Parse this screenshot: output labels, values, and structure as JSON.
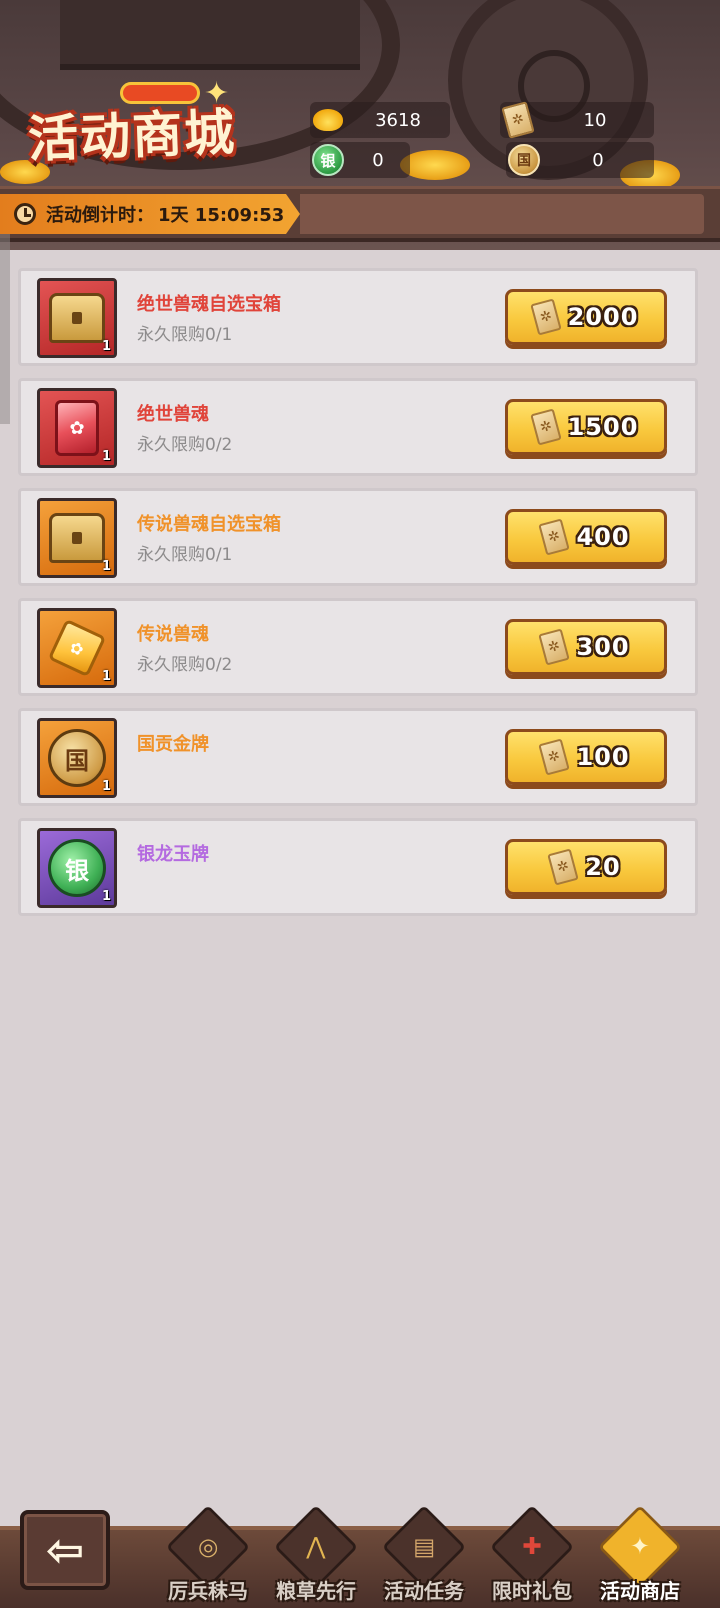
{
  "header": {
    "title": "活动商城",
    "currencies": [
      {
        "icon": "gold-ingot-icon",
        "value": "3618"
      },
      {
        "icon": "activity-ticket-icon",
        "value": "10"
      },
      {
        "icon": "silver-dragon-medal-icon",
        "glyph": "银",
        "value": "0"
      },
      {
        "icon": "national-gold-medal-icon",
        "glyph": "国",
        "value": "0"
      }
    ],
    "countdown_label": "活动倒计时：",
    "countdown_value": "1天 15:09:53"
  },
  "items": [
    {
      "name": "绝世兽魂自选宝箱",
      "name_color": "#e0443a",
      "limit": "永久限购0/1",
      "icon": "chest-icon",
      "frame": "red",
      "qty": "1",
      "price": "2000"
    },
    {
      "name": "绝世兽魂",
      "name_color": "#e0443a",
      "limit": "永久限购0/2",
      "icon": "red-beast-soul-gem-icon",
      "frame": "red",
      "qty": "1",
      "price": "1500"
    },
    {
      "name": "传说兽魂自选宝箱",
      "name_color": "#f0922a",
      "limit": "永久限购0/1",
      "icon": "chest-icon",
      "frame": "orange",
      "qty": "1",
      "price": "400"
    },
    {
      "name": "传说兽魂",
      "name_color": "#f0922a",
      "limit": "永久限购0/2",
      "icon": "orange-beast-soul-gem-icon",
      "frame": "orange",
      "qty": "1",
      "price": "300"
    },
    {
      "name": "国贡金牌",
      "name_color": "#f0922a",
      "limit": "",
      "icon": "national-gold-medal-icon",
      "frame": "orange",
      "qty": "1",
      "price": "100",
      "glyph": "国"
    },
    {
      "name": "银龙玉牌",
      "name_color": "#b46ae0",
      "limit": "",
      "icon": "silver-dragon-medal-icon",
      "frame": "purple",
      "qty": "1",
      "price": "20",
      "glyph": "银"
    }
  ],
  "nav": {
    "back_icon": "back-arrow-icon",
    "tabs": [
      {
        "label": "厉兵秣马",
        "icon": "compass-icon",
        "active": false
      },
      {
        "label": "粮草先行",
        "icon": "haystack-icon",
        "active": false
      },
      {
        "label": "活动任务",
        "icon": "scroll-icon",
        "active": false
      },
      {
        "label": "限时礼包",
        "icon": "gift-bundle-icon",
        "active": false
      },
      {
        "label": "活动商店",
        "icon": "shop-icon",
        "active": true
      }
    ]
  }
}
